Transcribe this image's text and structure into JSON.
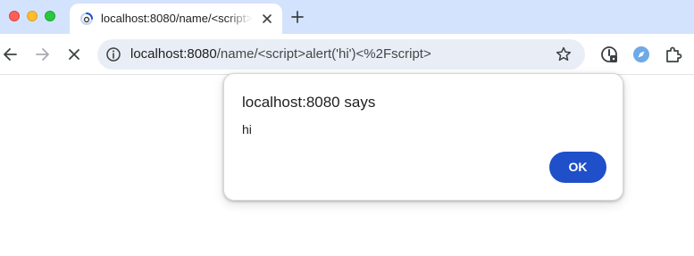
{
  "browser": {
    "tab": {
      "title": "localhost:8080/name/<script>",
      "loading_icon": "loading-spinner-icon",
      "close_icon": "close-icon"
    },
    "new_tab_icon": "plus-icon",
    "toolbar": {
      "back_icon": "arrow-left-icon",
      "forward_icon": "arrow-right-icon",
      "stop_icon": "close-icon",
      "site_info_icon": "info-icon",
      "url_host": "localhost:8080",
      "url_path": "/name/<script>alert('hi')<%2Fscript>",
      "bookmark_icon": "star-icon",
      "extension_icons": [
        "password-manager-icon",
        "compass-extension-icon",
        "puzzle-icon"
      ]
    }
  },
  "dialog": {
    "title": "localhost:8080 says",
    "message": "hi",
    "ok_label": "OK"
  },
  "colors": {
    "tabstrip_bg": "#d3e3fd",
    "omnibox_bg": "#e9eef6",
    "ok_button_bg": "#1f4fc9"
  }
}
